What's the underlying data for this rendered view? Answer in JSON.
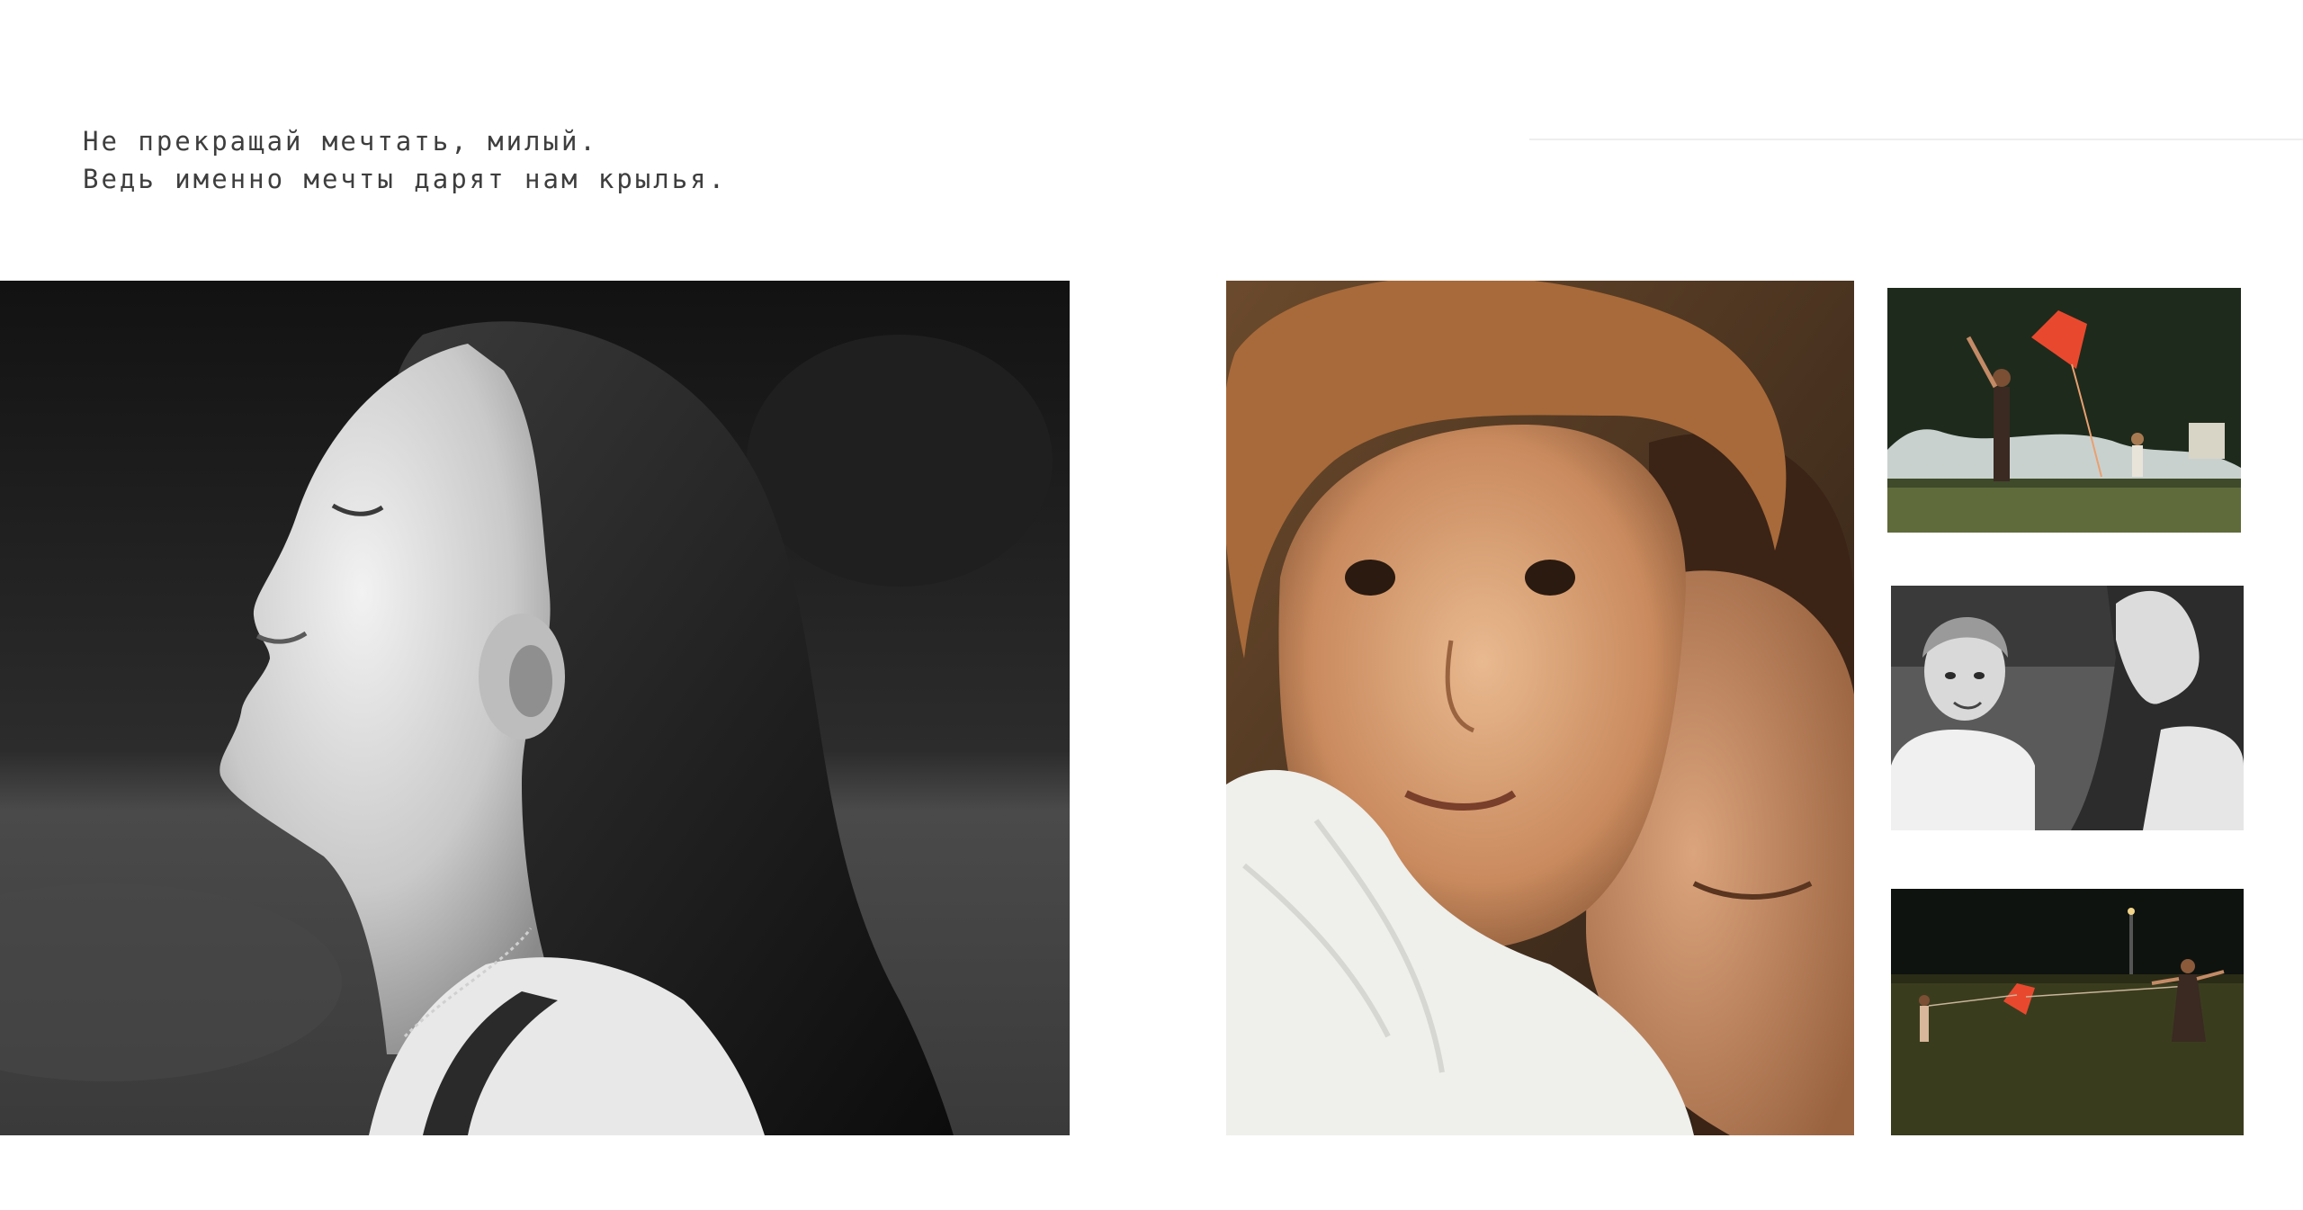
{
  "quote": {
    "line1": "Не прекращай мечтать, милый.",
    "line2": "Ведь именно мечты дарят нам крылья."
  },
  "photos": {
    "main": {
      "subject": "woman-profile-bw"
    },
    "hug": {
      "subject": "child-hugging-mother"
    },
    "kite_1": {
      "subject": "mother-son-flying-kite"
    },
    "play": {
      "subject": "boy-and-mother-bw"
    },
    "kite_2": {
      "subject": "kite-on-lawn-evening"
    }
  },
  "colors": {
    "background": "#ffffff",
    "text": "#3e3e3e",
    "kite": "#e8492e"
  }
}
